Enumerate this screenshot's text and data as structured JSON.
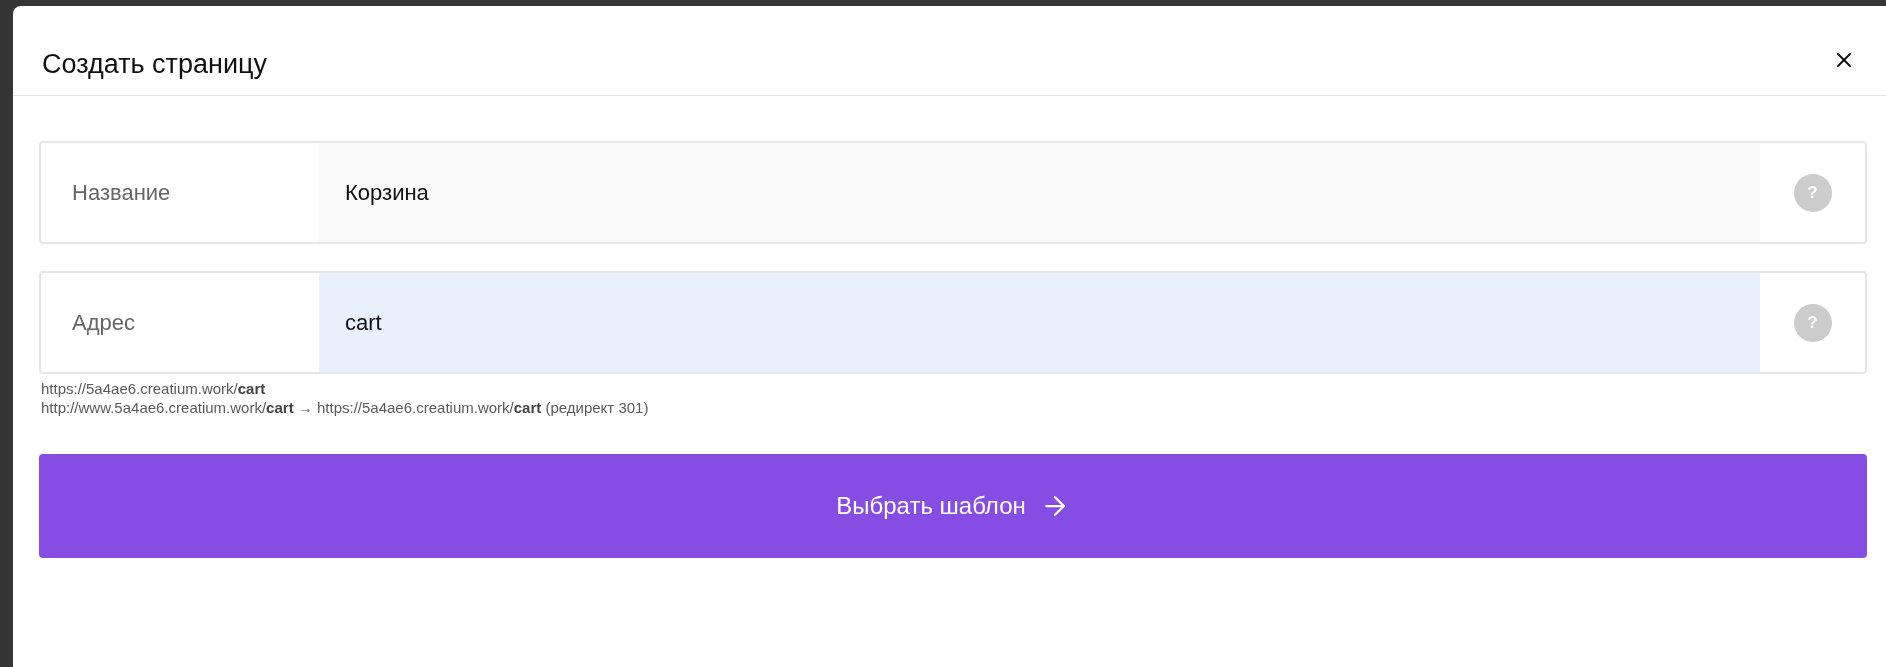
{
  "dialog": {
    "title": "Создать страницу"
  },
  "fields": [
    {
      "label": "Название",
      "value": "Корзина",
      "focused": false,
      "help": "?"
    },
    {
      "label": "Адрес",
      "value": "cart",
      "focused": true,
      "help": "?"
    }
  ],
  "url_hints": [
    "https://5a4ae6.creatium.work/**cart**",
    "http://www.5a4ae6.creatium.work/**cart** → https://5a4ae6.creatium.work/**cart** (редирект 301)"
  ],
  "submit_button": {
    "label": "Выбрать шаблон"
  }
}
